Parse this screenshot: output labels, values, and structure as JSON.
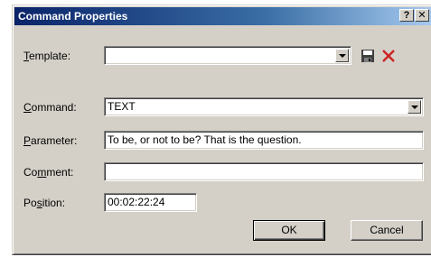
{
  "window": {
    "title": "Command Properties",
    "help_label": "?",
    "close_label": "✕"
  },
  "template": {
    "label": "Template:",
    "value": "",
    "save_icon": "floppy-disk-icon",
    "delete_icon": "red-x-icon"
  },
  "command": {
    "label": "Command:",
    "value": "TEXT"
  },
  "parameter": {
    "label": "Parameter:",
    "value": "To be, or not to be? That is the question."
  },
  "comment": {
    "label": "Comment:",
    "value": ""
  },
  "position": {
    "label": "Position:",
    "value": "00:02:22:24"
  },
  "buttons": {
    "ok": "OK",
    "cancel": "Cancel"
  }
}
